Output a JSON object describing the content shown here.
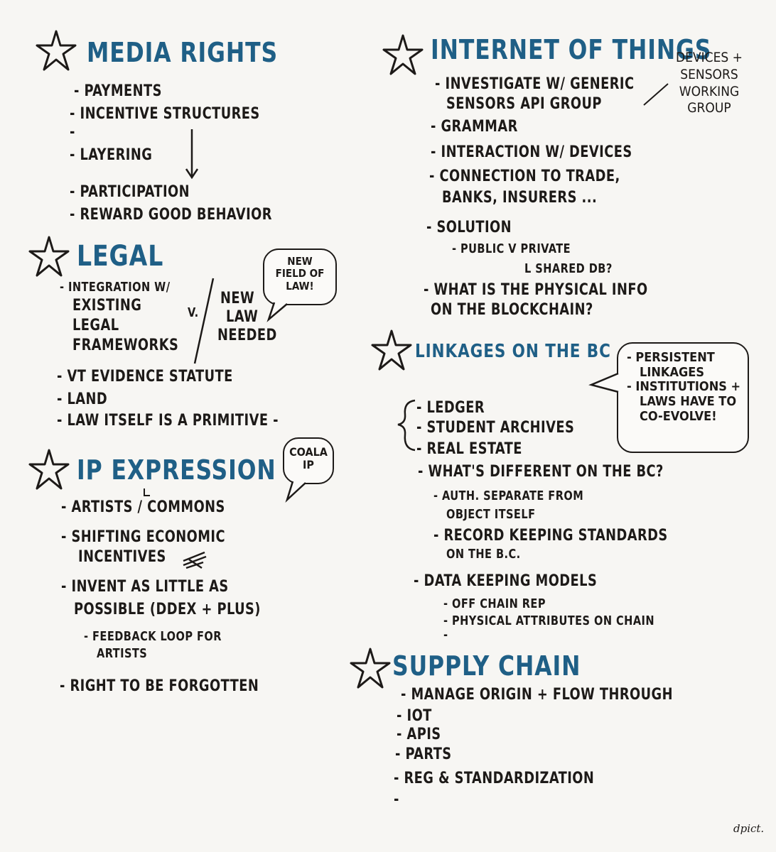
{
  "media_rights": {
    "heading": "MEDIA RIGHTS",
    "items": [
      "- PAYMENTS",
      "- INCENTIVE STRUCTURES",
      "-",
      "- LAYERING",
      "- PARTICIPATION",
      "- REWARD GOOD BEHAVIOR"
    ]
  },
  "legal": {
    "heading": "LEGAL",
    "integration_lines": [
      "- INTEGRATION w/",
      "EXISTING",
      "LEGAL",
      "FRAMEWORKS"
    ],
    "versus": "V.",
    "new_law_lines": [
      "NEW",
      "LAW",
      "NEEDED"
    ],
    "bubble_lines": [
      "NEW",
      "FIELD of",
      "LAW!"
    ],
    "items": [
      "- VT EVIDENCE STATUTE",
      "- LAND",
      "- LAW ITSELF is a PRIMITIVE -"
    ]
  },
  "ip_expression": {
    "heading": "IP EXPRESSION",
    "bubble_lines": [
      "COALA",
      "IP"
    ],
    "items": [
      "- ARTISTS / COMMONS",
      "- SHIFTING ECONOMIC",
      "INCENTIVES",
      "- INVENT as LITTLE as",
      "POSSIBLE (DDEX + PLUS)",
      "- FEEDBACK LOOP for",
      "ARTISTS",
      "- RIGHT to BE FORGOTTEN"
    ]
  },
  "internet_of_things": {
    "heading": "INTERNET of THINGS",
    "side_note_lines": [
      "DEVICES +",
      "SENSORS",
      "WORKING",
      "GROUP"
    ],
    "items": [
      "- INVESTIGATE w/ GENERIC",
      "SENSORS API GROUP",
      "- GRAMMAR",
      "- INTERACTION w/ DEVICES",
      "- CONNECTION to TRADE,",
      "BANKS, INSURERS ...",
      "- SOLUTION",
      "- PUBLIC v PRIVATE",
      "L SHARED DB?",
      "- WHAT is the PHYSICAL INFO",
      "on the BLOCKCHAIN?"
    ]
  },
  "linkages": {
    "heading": "LINKAGES ON the BC",
    "bubble_lines": [
      "- PERSISTENT",
      "LINKAGES",
      "- INSTITUTIONS +",
      "LAWS HAVE to",
      "CO-EVOLVE!"
    ],
    "items": [
      "- LEDGER",
      "- STUDENT ARCHIVES",
      "- REAL ESTATE",
      "- WHAT'S DIFFERENT on THE BC?",
      "- AUTH. SEPARATE FROM",
      "OBJECT ITSELF",
      "- RECORD KEEPING STANDARDS",
      "on the B.C.",
      "- DATA KEEPING MODELS",
      "- OFF CHAIN REP",
      "- PHYSICAL ATTRIBUTES ON CHAIN",
      "-"
    ]
  },
  "supply_chain": {
    "heading": "SUPPLY CHAIN",
    "items": [
      "- MANAGE ORIGIN + FLOW THROUGH",
      "- IoT",
      "- APIs",
      "- PARTS",
      "- REG & STANDARDIZATION",
      "-"
    ]
  },
  "signature": "dpict.",
  "colors": {
    "heading": "#1f5f86",
    "ink": "#1d1a18",
    "paper": "#f7f6f3"
  }
}
